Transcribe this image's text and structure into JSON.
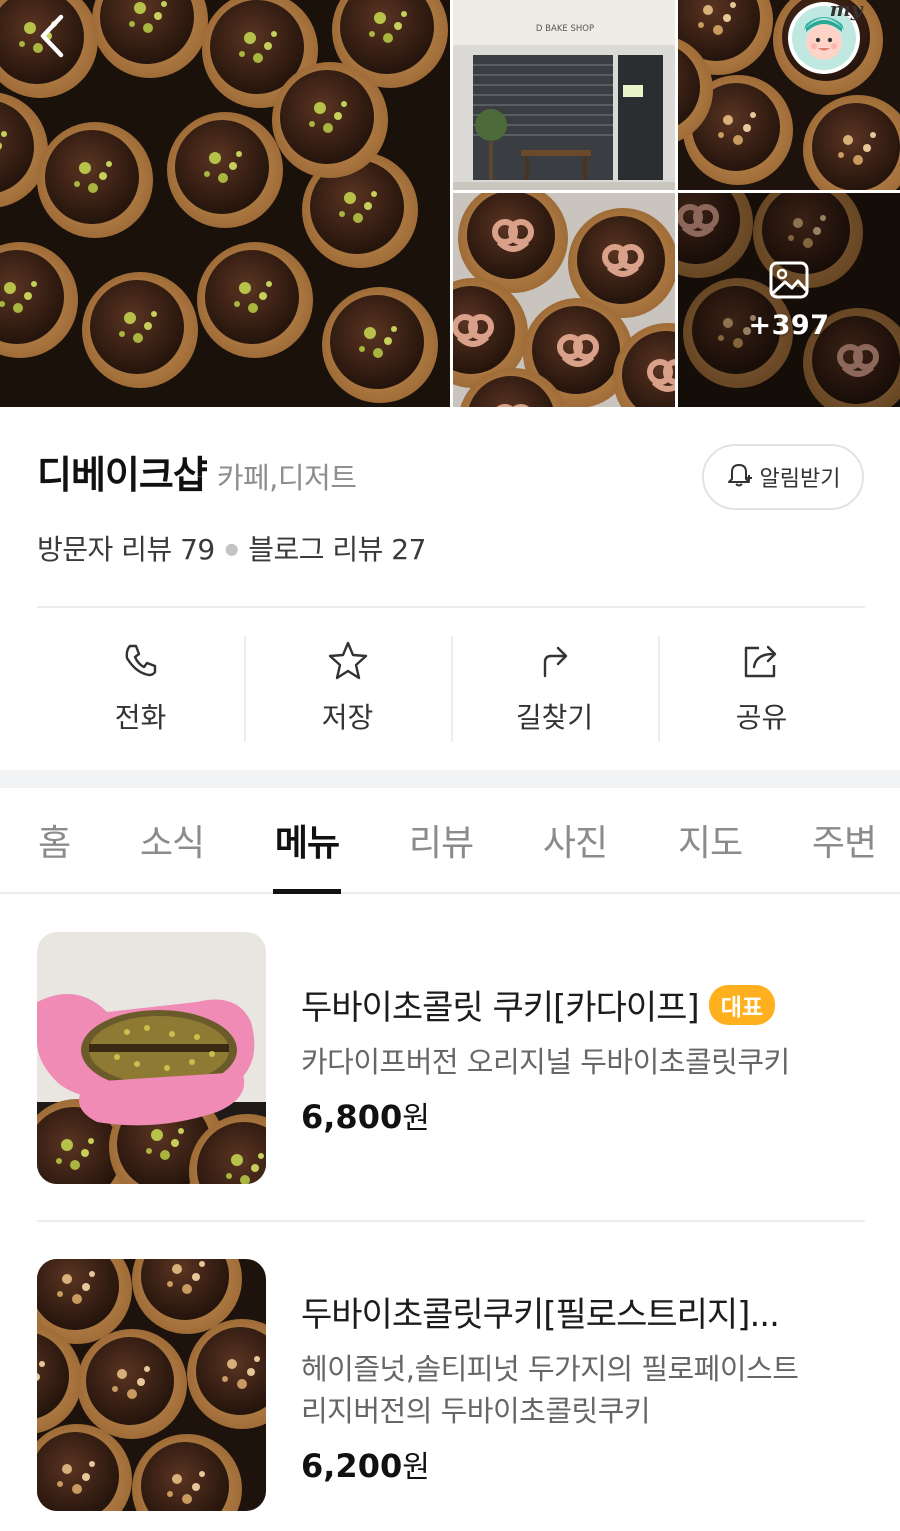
{
  "gallery": {
    "storefront_sign": "D BAKE SHOP",
    "more_count": "+397",
    "my_badge": "my"
  },
  "place": {
    "name": "디베이크샵",
    "category": "카페,디저트",
    "alarm_label": "알림받기",
    "visitor_reviews": "방문자 리뷰 79",
    "blog_reviews": "블로그 리뷰 27"
  },
  "actions": [
    {
      "label": "전화",
      "icon": "phone-icon"
    },
    {
      "label": "저장",
      "icon": "star-icon"
    },
    {
      "label": "길찾기",
      "icon": "directions-icon"
    },
    {
      "label": "공유",
      "icon": "share-icon"
    }
  ],
  "tabs": [
    "홈",
    "소식",
    "메뉴",
    "리뷰",
    "사진",
    "지도",
    "주변"
  ],
  "active_tab": "메뉴",
  "menu": [
    {
      "title": "두바이초콜릿 쿠키[카다이프]",
      "badge": "대표",
      "desc_lines": [
        "카다이프버전 오리지널 두바이초콜릿쿠키"
      ],
      "price": "6,800",
      "currency": "원"
    },
    {
      "title": "두바이초콜릿쿠키[필로스트리지]...",
      "badge": "",
      "desc_lines": [
        "헤이즐넛,솔티피넛 두가지의 필로페이스트",
        "리지버전의 두바이초콜릿쿠키"
      ],
      "price": "6,200",
      "currency": "원"
    }
  ],
  "colors": {
    "badge": "#ffb01e",
    "chocolate": "#3b2216",
    "cookie": "#b9844a",
    "pistachio": "#b6c24a"
  }
}
